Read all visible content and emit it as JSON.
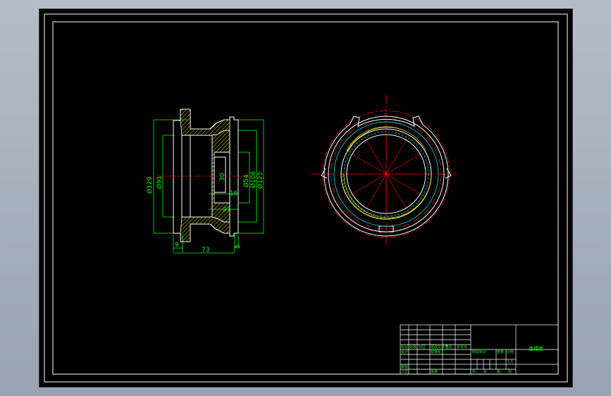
{
  "drawing": {
    "colors": {
      "background": "#000000",
      "frame": "#ffffff",
      "outline": "#ffffff",
      "dimension": "#00ff00",
      "centerline": "#ff0000",
      "section_hatch": "#ffff00",
      "hidden_line": "#00ffff"
    },
    "section_view": {
      "diameters": {
        "d129": "Ø129",
        "d91": "Ø91",
        "d106": "Ø106",
        "d54": "Ø54",
        "d125": "Ø125"
      },
      "dims": {
        "d16": "16",
        "d27": "27",
        "d9": "9",
        "d73": "73",
        "d5": "5",
        "d30": "30"
      }
    },
    "title_block": {
      "part_name": "连接座",
      "scale": "1:1",
      "labels": {
        "mark": "标记",
        "count": "处数",
        "zone": "分区",
        "doc_no": "更改文件号",
        "sign": "签名",
        "date": "年月日",
        "design": "设计",
        "standard": "标准化",
        "review": "审核",
        "process": "工艺",
        "approve": "批准",
        "stage_mark": "阶段标记",
        "weight": "重量",
        "scale_label": "比例",
        "total": "共",
        "sheet_unit": "张",
        "page": "第"
      }
    }
  }
}
